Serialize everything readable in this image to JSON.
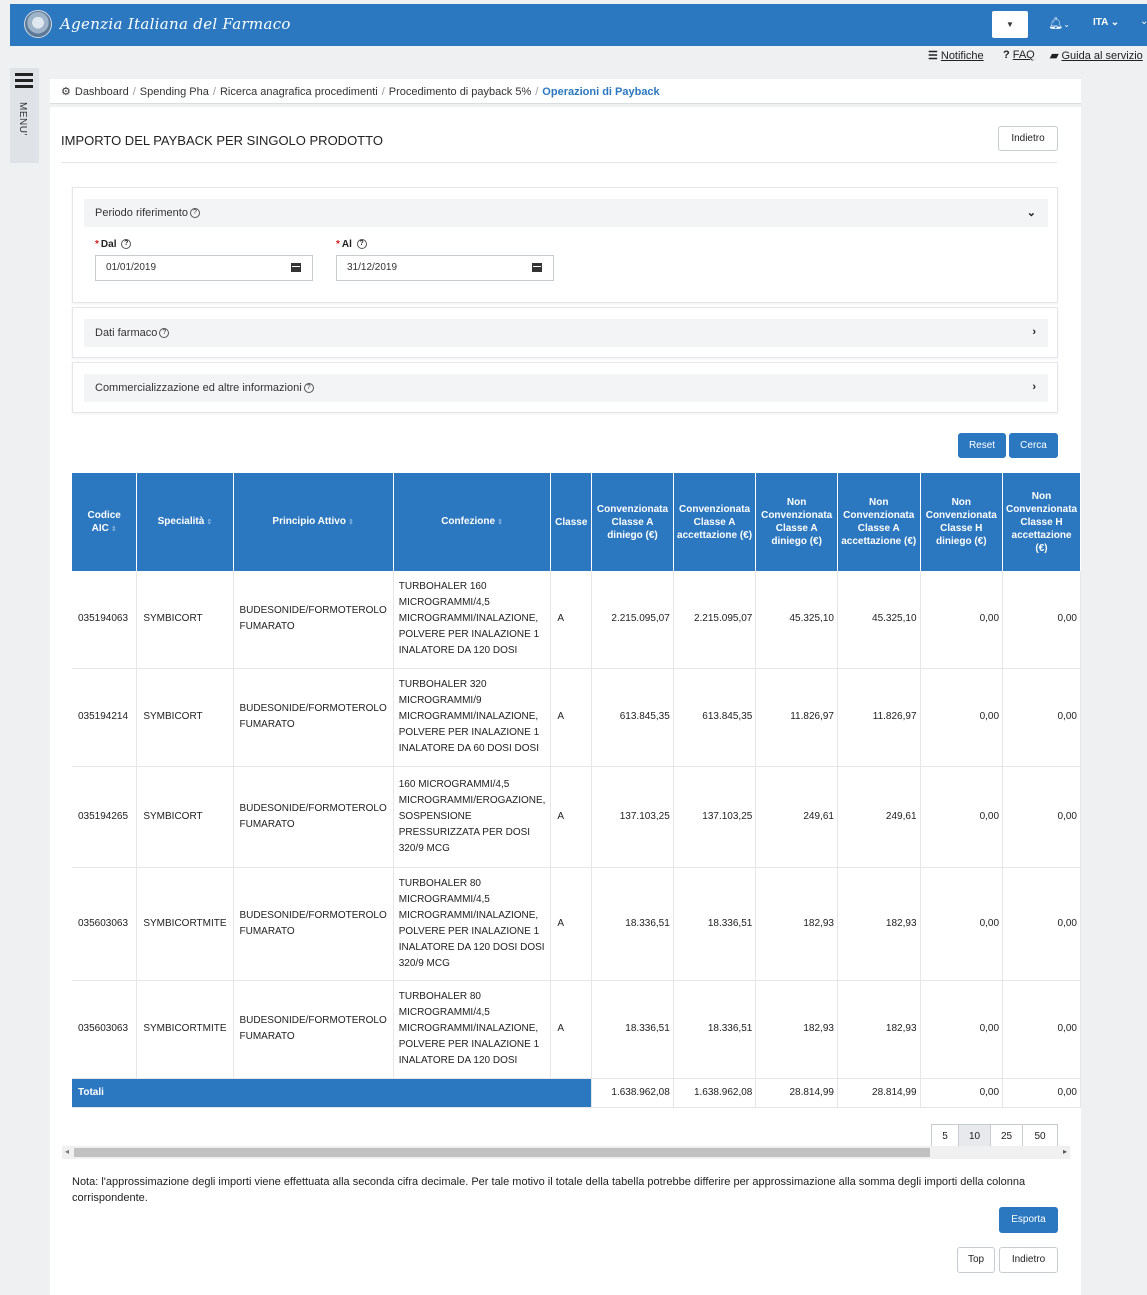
{
  "header": {
    "agency_name": "Agenzia Italiana del Farmaco",
    "logo_icon": "government-seal-icon",
    "notification_icon": "bell-icon",
    "language": "ITA",
    "utility_links": {
      "notifiche": "Notifiche",
      "faq": "FAQ",
      "guida": "Guida al servizio"
    }
  },
  "side_menu": {
    "label": "MENU'"
  },
  "breadcrumb": {
    "items": [
      "Dashboard",
      "Spending Pha",
      "Ricerca anagrafica procedimenti",
      "Procedimento di payback 5%"
    ],
    "active": "Operazioni di Payback"
  },
  "page": {
    "title": "IMPORTO DEL PAYBACK PER SINGOLO PRODOTTO",
    "back_label": "Indietro"
  },
  "filters": {
    "periodo": {
      "title": "Periodo riferimento",
      "dal_label": "Dal",
      "dal_value": "01/01/2019",
      "al_label": "Al",
      "al_value": "31/12/2019",
      "expanded": true
    },
    "dati_farmaco": {
      "title": "Dati farmaco",
      "expanded": false
    },
    "commercializzazione": {
      "title": "Commercializzazione ed altre informazioni",
      "expanded": false
    },
    "reset_label": "Reset",
    "cerca_label": "Cerca"
  },
  "table": {
    "headers": [
      "Codice AIC",
      "Specialità",
      "Principio Attivo",
      "Confezione",
      "Classe",
      "Convenzionata Classe A diniego (€)",
      "Convenzionata Classe A accettazione (€)",
      "Non Convenzionata Classe A diniego (€)",
      "Non Convenzionata Classe A accettazione (€)",
      "Non Convenzionata Classe H diniego (€)",
      "Non Convenzionata Classe H accettazione (€)"
    ],
    "rows": [
      [
        "035194063",
        "SYMBICORT",
        "BUDESONIDE/FORMOTEROLO FUMARATO",
        "TURBOHALER 160 MICROGRAMMI/4,5 MICROGRAMMI/INALAZIONE, POLVERE PER INALAZIONE 1 INALATORE DA 120 DOSI",
        "A",
        "2.215.095,07",
        "2.215.095,07",
        "45.325,10",
        "45.325,10",
        "0,00",
        "0,00"
      ],
      [
        "035194214",
        "SYMBICORT",
        "BUDESONIDE/FORMOTEROLO FUMARATO",
        "TURBOHALER 320 MICROGRAMMI/9 MICROGRAMMI/INALAZIONE, POLVERE PER INALAZIONE 1 INALATORE DA 60 DOSI DOSI",
        "A",
        "613.845,35",
        "613.845,35",
        "11.826,97",
        "11.826,97",
        "0,00",
        "0,00"
      ],
      [
        "035194265",
        "SYMBICORT",
        "BUDESONIDE/FORMOTEROLO FUMARATO",
        "160 MICROGRAMMI/4,5 MICROGRAMMI/EROGAZIONE, SOSPENSIONE PRESSURIZZATA PER DOSI 320/9 MCG",
        "A",
        "137.103,25",
        "137.103,25",
        "249,61",
        "249,61",
        "0,00",
        "0,00"
      ],
      [
        "035603063",
        "SYMBICORTMITE",
        "BUDESONIDE/FORMOTEROLO FUMARATO",
        "TURBOHALER 80 MICROGRAMMI/4,5 MICROGRAMMI/INALAZIONE, POLVERE PER INALAZIONE 1 INALATORE DA 120 DOSI DOSI 320/9 MCG",
        "A",
        "18.336,51",
        "18.336,51",
        "182,93",
        "182,93",
        "0,00",
        "0,00"
      ],
      [
        "035603063",
        "SYMBICORTMITE",
        "BUDESONIDE/FORMOTEROLO FUMARATO",
        "TURBOHALER 80 MICROGRAMMI/4,5 MICROGRAMMI/INALAZIONE, POLVERE PER INALAZIONE 1 INALATORE DA 120 DOSI",
        "A",
        "18.336,51",
        "18.336,51",
        "182,93",
        "182,93",
        "0,00",
        "0,00"
      ]
    ],
    "totals_label": "Totali",
    "totals": [
      "1.638.962,08",
      "1.638.962,08",
      "28.814,99",
      "28.814,99",
      "0,00",
      "0,00"
    ]
  },
  "pagination": {
    "sizes": [
      "5",
      "10",
      "25",
      "50"
    ],
    "selected": "10"
  },
  "note": "Nota: l'approssimazione degli importi viene effettuata alla seconda cifra decimale. Per tale motivo il totale della tabella potrebbe differire per approssimazione alla somma degli importi della colonna corrispondente.",
  "actions": {
    "esporta": "Esporta",
    "top": "Top",
    "indietro": "Indietro"
  },
  "colors": {
    "primary": "#2b78c0",
    "required": "#d12020"
  }
}
